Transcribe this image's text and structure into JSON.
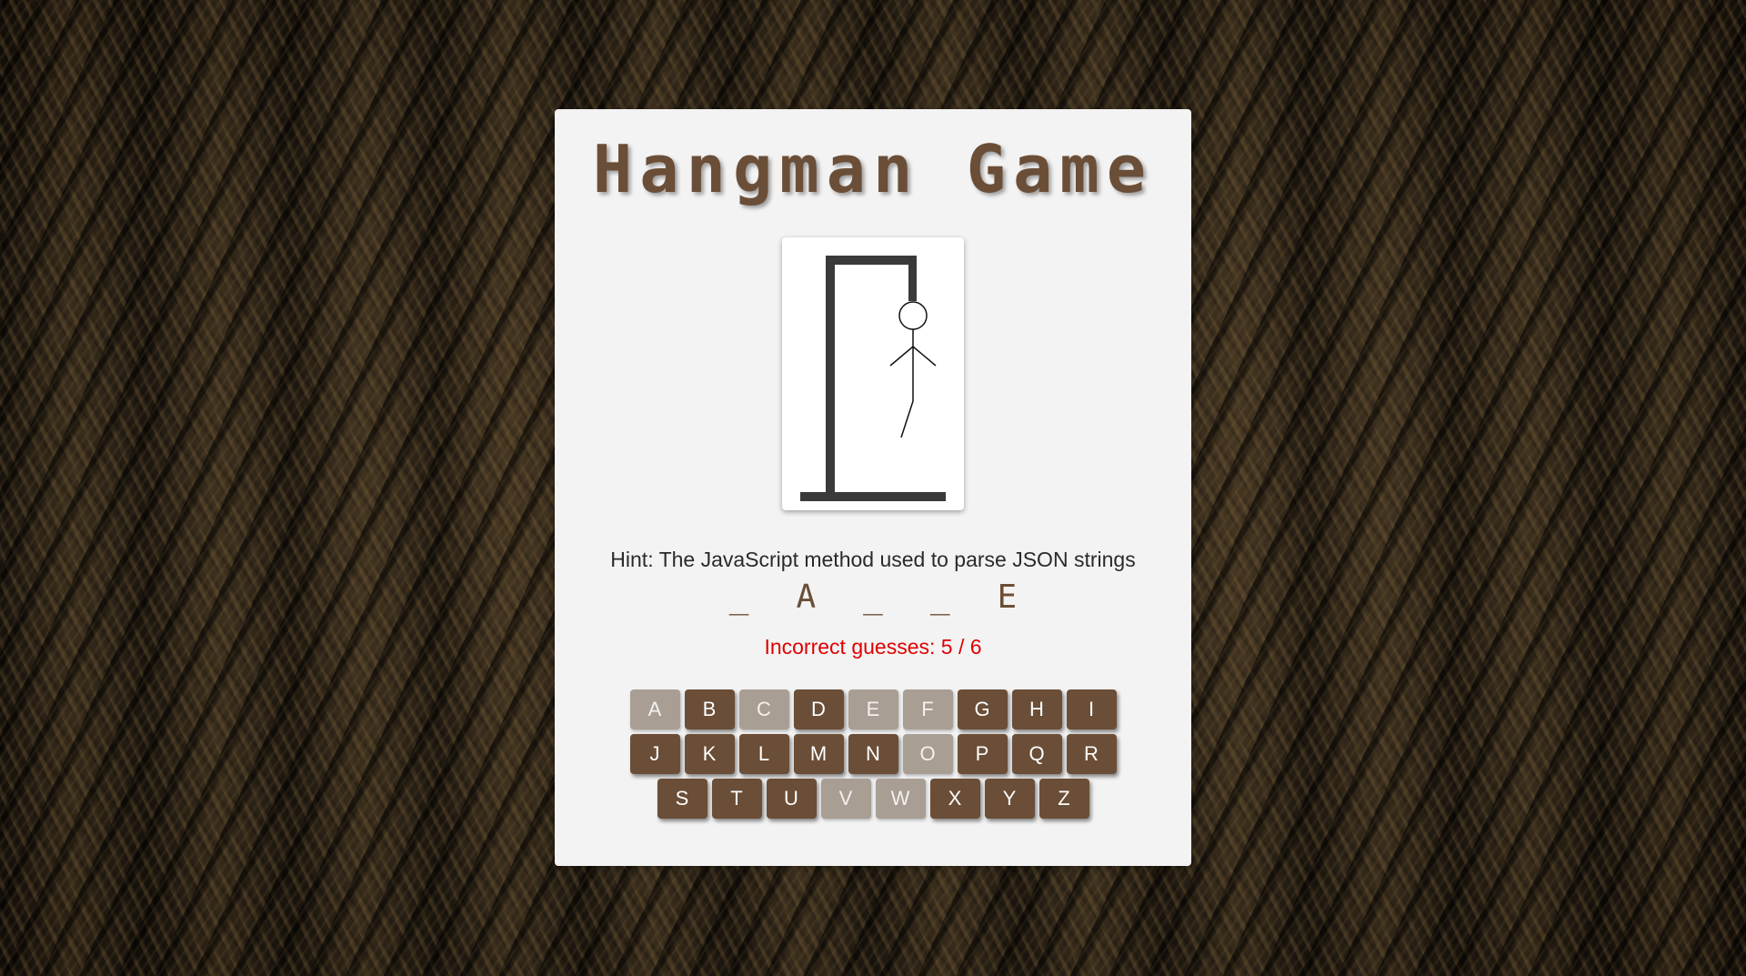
{
  "game": {
    "title": "Hangman Game",
    "hint": "Hint: The JavaScript method used to parse JSON strings",
    "word_display": [
      "_",
      "A",
      "_",
      "_",
      "E"
    ],
    "incorrect_guesses_text": "Incorrect guesses: 5 / 6",
    "incorrect_count": 5,
    "max_incorrect": 6
  },
  "keyboard": {
    "rows": [
      [
        {
          "letter": "A",
          "used": true
        },
        {
          "letter": "B",
          "used": false
        },
        {
          "letter": "C",
          "used": true
        },
        {
          "letter": "D",
          "used": false
        },
        {
          "letter": "E",
          "used": true
        },
        {
          "letter": "F",
          "used": true
        },
        {
          "letter": "G",
          "used": false
        },
        {
          "letter": "H",
          "used": false
        },
        {
          "letter": "I",
          "used": false
        }
      ],
      [
        {
          "letter": "J",
          "used": false
        },
        {
          "letter": "K",
          "used": false
        },
        {
          "letter": "L",
          "used": false
        },
        {
          "letter": "M",
          "used": false
        },
        {
          "letter": "N",
          "used": false
        },
        {
          "letter": "O",
          "used": true
        },
        {
          "letter": "P",
          "used": false
        },
        {
          "letter": "Q",
          "used": false
        },
        {
          "letter": "R",
          "used": false
        }
      ],
      [
        {
          "letter": "S",
          "used": false
        },
        {
          "letter": "T",
          "used": false
        },
        {
          "letter": "U",
          "used": false
        },
        {
          "letter": "V",
          "used": true
        },
        {
          "letter": "W",
          "used": true
        },
        {
          "letter": "X",
          "used": false
        },
        {
          "letter": "Y",
          "used": false
        },
        {
          "letter": "Z",
          "used": false
        }
      ]
    ]
  },
  "colors": {
    "accent": "#6b4e37",
    "key_used": "#a89e94",
    "error_text": "#e00000",
    "card_bg": "#f3f3f3",
    "gallows": "#3a3a3a"
  }
}
